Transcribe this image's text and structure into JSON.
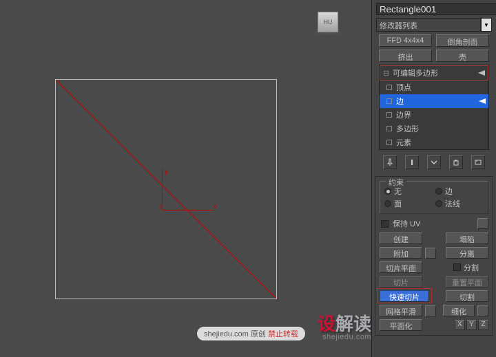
{
  "viewcube": {
    "face": "HU"
  },
  "axis": {
    "x": "x",
    "y": "y",
    "z": "z"
  },
  "watermark": {
    "big1": "设",
    "big2": "解读",
    "url": "shejiedu.com",
    "tag_site": "shejiedu.com 原创",
    "tag_ban": "禁止转载"
  },
  "object_name": "Rectangle001",
  "modifier_dropdown": "修改器列表",
  "preset_buttons": {
    "ffd": "FFD 4x4x4",
    "chamfer": "倒角剖面",
    "extrude": "挤出",
    "shell": "壳"
  },
  "stack": {
    "header": "可编辑多边形",
    "items": [
      "顶点",
      "边",
      "边界",
      "多边形",
      "元素"
    ],
    "selected_index": 1
  },
  "constraint": {
    "legend": "约束",
    "none": "无",
    "edge": "边",
    "face": "面",
    "normal": "法线"
  },
  "preserve_uv": "保持 UV",
  "buttons": {
    "create": "创建",
    "collapse": "塌陷",
    "attach": "附加",
    "detach": "分离",
    "slice_plane": "切片平面",
    "split": "分割",
    "slice": "切片",
    "reset_plane": "重置平面",
    "quickslice": "快速切片",
    "cut": "切割",
    "msmooth": "网格平滑",
    "tessellate": "细化",
    "planarize": "平面化"
  },
  "xyz": {
    "x": "X",
    "y": "Y",
    "z": "Z"
  }
}
